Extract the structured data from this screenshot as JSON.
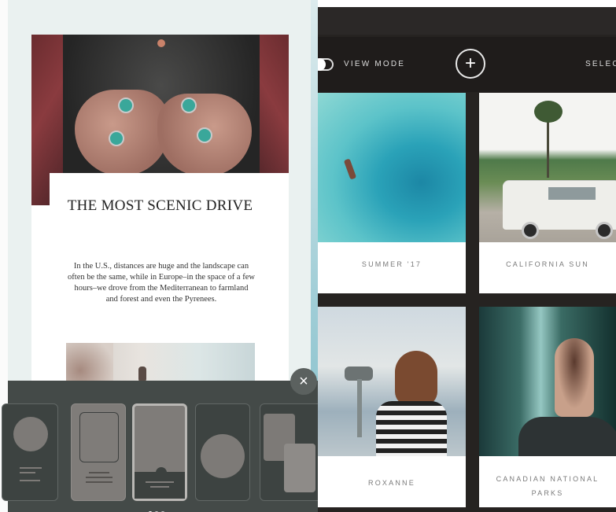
{
  "story": {
    "title": "THE MOST SCENIC DRIVE",
    "body": "In the U.S., distances are huge and the landscape can often be the same, while in Europe–in the space of a few hours–we drove from the Mediterranean to farmland and forest and even the Pyrenees."
  },
  "editor": {
    "close_label": "×",
    "templates": [
      "template-circle-text",
      "template-framed",
      "template-full-bleed",
      "template-circle",
      "template-stacked"
    ],
    "selected_template": 2,
    "pages": {
      "total": 3,
      "current": 1
    }
  },
  "library": {
    "view_mode_label": "VIEW MODE",
    "add_label": "+",
    "select_label": "SELEC",
    "albums": [
      {
        "title": "SUMMER '17"
      },
      {
        "title": "CALIFORNIA SUN"
      },
      {
        "title": "ROXANNE"
      },
      {
        "title": "CANADIAN NATIONAL PARKS"
      }
    ]
  },
  "colors": {
    "tray": "#444a48",
    "library_bg": "#262321",
    "label_text": "#7a7a7a"
  }
}
